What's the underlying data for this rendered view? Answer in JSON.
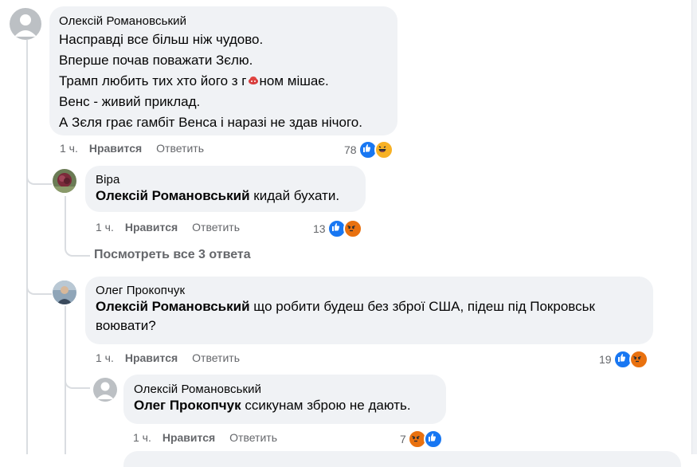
{
  "comments": [
    {
      "author": "Олексій Романовський",
      "lines": [
        "Насправді все більш ніж чудово.",
        "Вперше почав поважати Зєлю.",
        "Трамп любить тих хто його з г",
        "Венс - живий приклад.",
        "А Зєля грає гамбіт Венса і наразі не здав нічого."
      ],
      "line3_tail": "ном мішає.",
      "time": "1 ч.",
      "like_label": "Нравится",
      "reply_label": "Ответить",
      "reaction_count": "78",
      "reactions": [
        "like-icon",
        "haha-icon"
      ]
    },
    {
      "author": "Віра",
      "mention": "Олексій Романовський",
      "text": " кидай бухати.",
      "time": "1 ч.",
      "like_label": "Нравится",
      "reply_label": "Ответить",
      "reaction_count": "13",
      "reactions": [
        "like-icon",
        "angry-icon"
      ]
    },
    {
      "view_all": "Посмотреть все 3 ответа"
    },
    {
      "author": "Олег Прокопчук",
      "mention": "Олексій Романовський",
      "text_line1": " що робити будеш без зброї США, підеш під Покровськ",
      "text_line2": "воювати?",
      "time": "1 ч.",
      "like_label": "Нравится",
      "reply_label": "Ответить",
      "reaction_count": "19",
      "reactions": [
        "like-icon",
        "angry-icon"
      ]
    },
    {
      "author": "Олексій Романовський",
      "mention": "Олег Прокопчук",
      "text": " ссикунам зброю не дають.",
      "time": "1 ч.",
      "like_label": "Нравится",
      "reply_label": "Ответить",
      "reaction_count": "7",
      "reactions": [
        "angry-icon",
        "like-icon"
      ]
    }
  ],
  "colors": {
    "bubble": "#f0f2f5",
    "text": "#050505",
    "meta": "#65676b",
    "like": "#1877f2",
    "angry": "#e9710f",
    "haha": "#f7b125",
    "thread_line": "#dadde1"
  }
}
